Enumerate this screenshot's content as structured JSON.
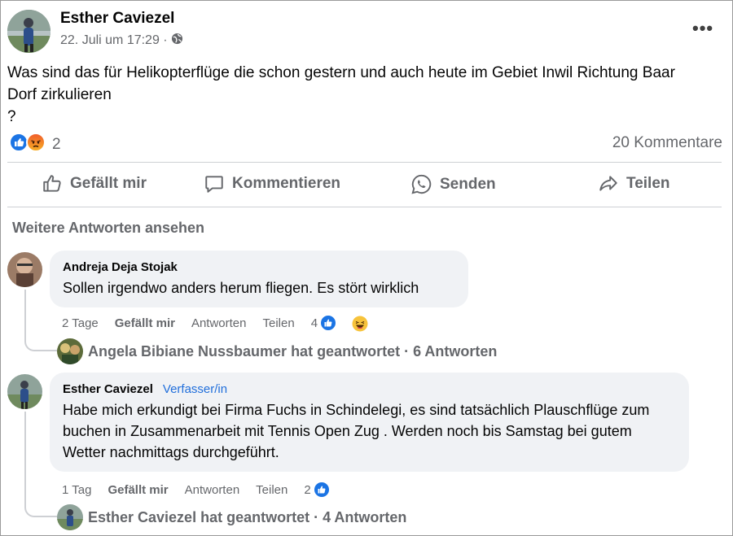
{
  "post": {
    "author": "Esther Caviezel",
    "date": "22. Juli um 17:29 ·",
    "text": "Was sind das für Helikopterflüge die schon gestern und auch heute im Gebiet Inwil Richtung Baar\nDorf zirkulieren\n?",
    "reaction_count": "2",
    "reaction_icons": [
      "like-icon",
      "angry-icon"
    ],
    "comments_count": "20 Kommentare",
    "privacy_icon": "globe-icon",
    "more_icon": "more-options-icon"
  },
  "actions": {
    "like": "Gefällt mir",
    "comment": "Kommentieren",
    "send": "Senden",
    "share": "Teilen"
  },
  "more_answers": "Weitere Antworten ansehen",
  "comments": [
    {
      "name": "Andreja Deja Stojak",
      "text": "Sollen irgendwo anders herum fliegen. Es stört wirklich",
      "time": "2 Tage",
      "like": "Gefällt mir",
      "reply": "Antworten",
      "share": "Teilen",
      "reaction_count": "4",
      "reaction_icons": [
        "like-icon",
        "laugh-icon"
      ],
      "replied": "Angela Bibiane Nussbaumer hat geantwortet · 6 Antworten"
    },
    {
      "name": "Esther Caviezel",
      "badge": "Verfasser/in",
      "text": "Habe mich erkundigt bei Firma Fuchs in Schindelegi, es sind tatsächlich Plauschflüge zum buchen in Zusammenarbeit mit Tennis Open Zug . Werden noch bis Samstag bei gutem Wetter nachmittags durchgeführt.",
      "time": "1 Tag",
      "like": "Gefällt mir",
      "reply": "Antworten",
      "share": "Teilen",
      "reaction_count": "2",
      "reaction_icons": [
        "like-icon"
      ],
      "replied": "Esther Caviezel hat geantwortet · 4 Antworten"
    }
  ],
  "colors": {
    "accent": "#1b74e4",
    "muted": "#65676b",
    "bubble": "#f0f2f5",
    "badge": "#216fdb"
  }
}
